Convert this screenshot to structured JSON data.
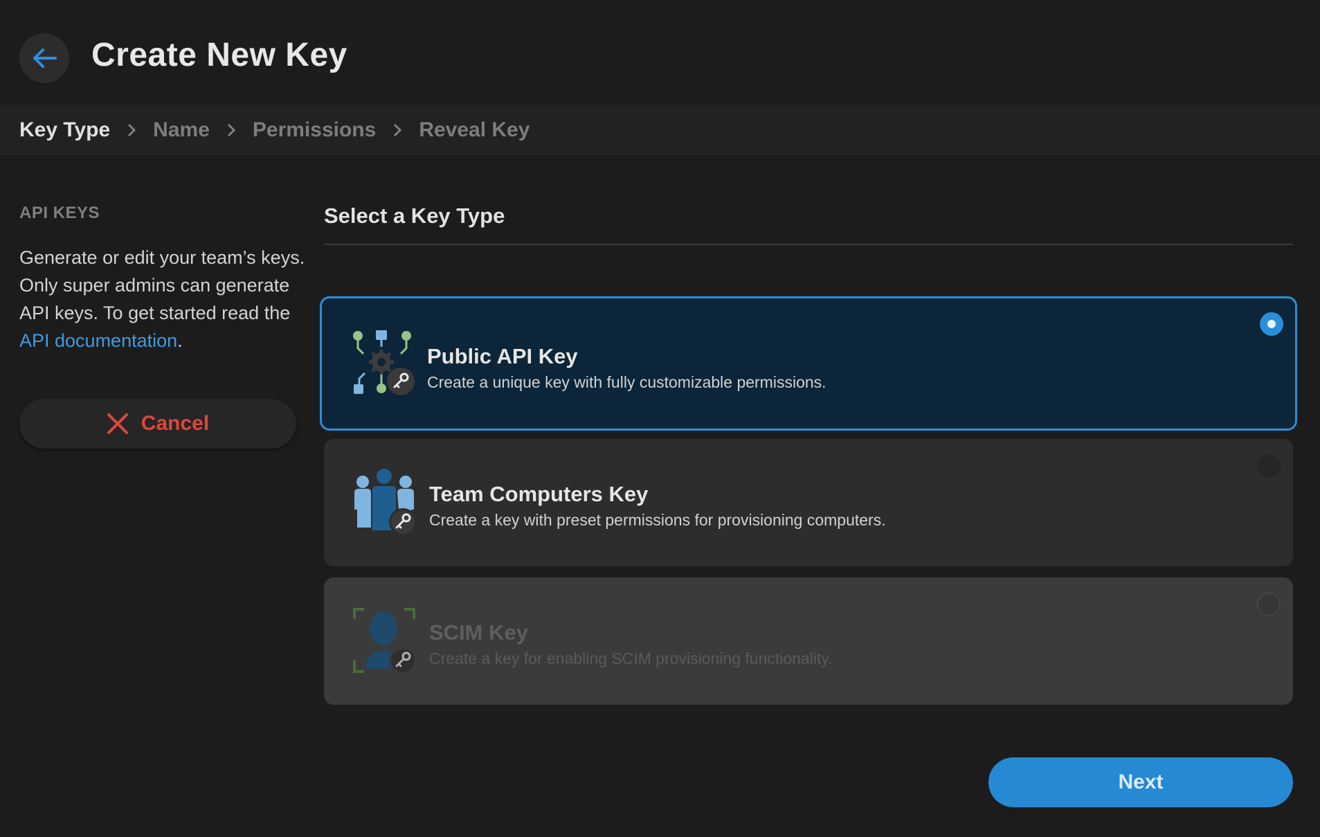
{
  "header": {
    "title": "Create New Key"
  },
  "steps": [
    {
      "label": "Key Type",
      "active": true
    },
    {
      "label": "Name",
      "active": false
    },
    {
      "label": "Permissions",
      "active": false
    },
    {
      "label": "Reveal Key",
      "active": false
    }
  ],
  "sidebar": {
    "heading": "API KEYS",
    "description": "Generate or edit your team’s keys. Only super admins can generate API keys. To get started read the ",
    "link_text": "API documentation",
    "trailing": ".",
    "cancel_label": "Cancel"
  },
  "main": {
    "title": "Select a Key Type",
    "options": [
      {
        "title": "Public API Key",
        "description": "Create a unique key with fully customizable permissions.",
        "selected": true,
        "disabled": false,
        "icon": "api-network-key-icon"
      },
      {
        "title": "Team Computers Key",
        "description": "Create a key with preset permissions for provisioning computers.",
        "selected": false,
        "disabled": false,
        "icon": "team-people-key-icon"
      },
      {
        "title": "SCIM Key",
        "description": "Create a key for enabling SCIM provisioning functionality.",
        "selected": false,
        "disabled": true,
        "icon": "scim-user-key-icon"
      }
    ],
    "next_label": "Next"
  },
  "colors": {
    "accent": "#2a8fd8",
    "danger": "#e0463a",
    "background": "#1c1c1c",
    "selected_card": "#0c2538"
  }
}
